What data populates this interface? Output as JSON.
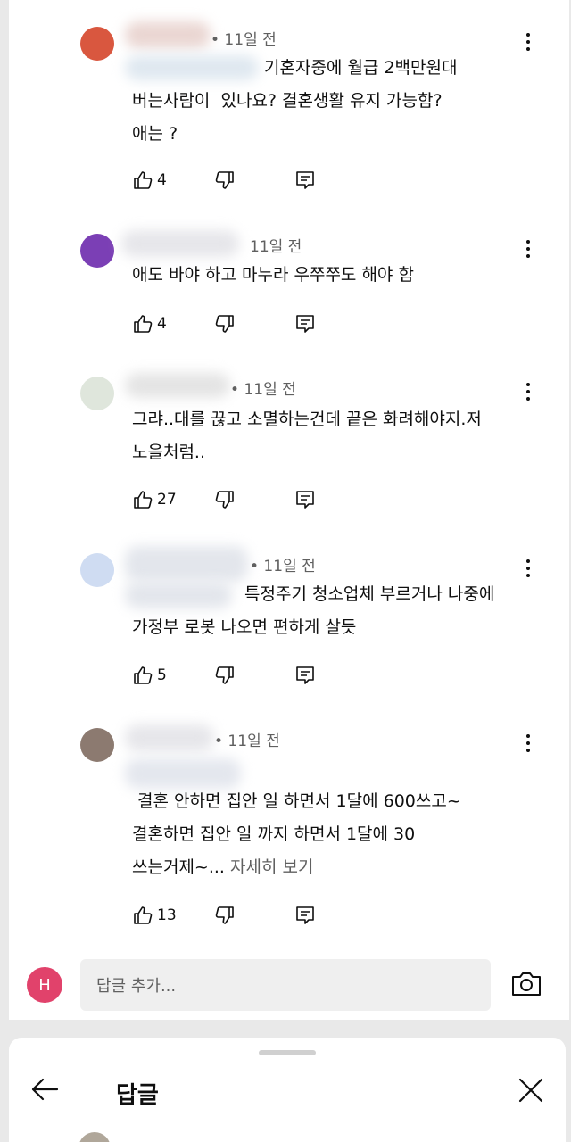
{
  "comments": [
    {
      "time": "• 11일 전",
      "text": "기혼자중에 월급 2백만원대\n버는사람이  있나요? 결혼생활 유지 가능함?\n애는 ?",
      "likes": "4"
    },
    {
      "time": "11일 전",
      "text": "애도 바야 하고 마누라 우쭈쭈도 해야 함",
      "likes": "4"
    },
    {
      "time": "• 11일 전",
      "text": "그랴..대를 끊고 소멸하는건데 끝은 화려해야지.저\n노을처럼..",
      "likes": "27"
    },
    {
      "time": "• 11일 전",
      "text": "특정주기 청소업체 부르거나 나중에\n가정부 로봇 나오면 편하게 살듯",
      "likes": "5"
    },
    {
      "time": "• 11일 전",
      "text": " 결혼 안하면 집안 일 하면서 1달에 600쓰고~\n결혼하면 집안 일 까지 하면서 1달에 30\n쓰는거제~... ",
      "more_label": "자세히 보기",
      "likes": "13"
    }
  ],
  "reply_bar": {
    "avatar_letter": "H",
    "placeholder": "답글 추가..."
  },
  "sheet": {
    "title": "답글"
  },
  "icons": {
    "like": "thumb-up-icon",
    "dislike": "thumb-down-icon",
    "reply": "reply-icon",
    "menu": "more-vert-icon",
    "camera": "camera-icon",
    "back": "arrow-back-icon",
    "close": "close-icon"
  },
  "colors": {
    "avatar_h": "#e1426b",
    "secondary_text": "#606060"
  }
}
